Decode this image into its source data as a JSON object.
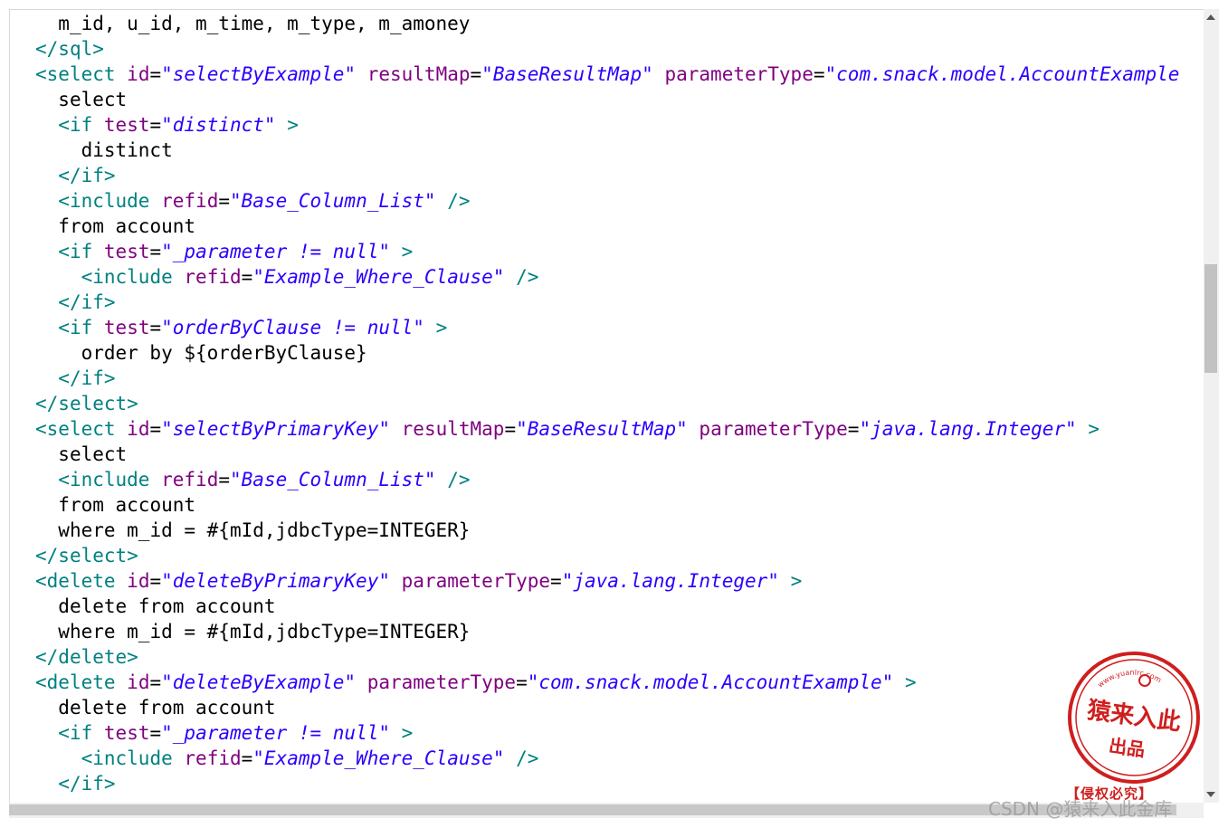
{
  "colors": {
    "tag": "#008080",
    "attribute": "#7f007f",
    "value": "#2a00ff",
    "text": "#000000",
    "stamp": "#d01e1e"
  },
  "code_lines": [
    {
      "indent": 1,
      "tokens": [
        {
          "t": "text",
          "v": "m_id, u_id, m_time, m_type, m_amoney"
        }
      ]
    },
    {
      "indent": 0,
      "tokens": [
        {
          "t": "bracket",
          "v": "</"
        },
        {
          "t": "tag",
          "v": "sql"
        },
        {
          "t": "bracket",
          "v": ">"
        }
      ]
    },
    {
      "indent": 0,
      "tokens": [
        {
          "t": "bracket",
          "v": "<"
        },
        {
          "t": "tag",
          "v": "select"
        },
        {
          "t": "text",
          "v": " "
        },
        {
          "t": "attr",
          "v": "id"
        },
        {
          "t": "eq",
          "v": "="
        },
        {
          "t": "val",
          "v": "\"selectByExample\""
        },
        {
          "t": "text",
          "v": " "
        },
        {
          "t": "attr",
          "v": "resultMap"
        },
        {
          "t": "eq",
          "v": "="
        },
        {
          "t": "val",
          "v": "\"BaseResultMap\""
        },
        {
          "t": "text",
          "v": " "
        },
        {
          "t": "attr",
          "v": "parameterType"
        },
        {
          "t": "eq",
          "v": "="
        },
        {
          "t": "val",
          "v": "\"com.snack.model.AccountExample"
        }
      ]
    },
    {
      "indent": 1,
      "tokens": [
        {
          "t": "text",
          "v": "select"
        }
      ]
    },
    {
      "indent": 1,
      "tokens": [
        {
          "t": "bracket",
          "v": "<"
        },
        {
          "t": "tag",
          "v": "if"
        },
        {
          "t": "text",
          "v": " "
        },
        {
          "t": "attr",
          "v": "test"
        },
        {
          "t": "eq",
          "v": "="
        },
        {
          "t": "val",
          "v": "\"distinct\""
        },
        {
          "t": "text",
          "v": " "
        },
        {
          "t": "bracket",
          "v": ">"
        }
      ]
    },
    {
      "indent": 2,
      "tokens": [
        {
          "t": "text",
          "v": "distinct"
        }
      ]
    },
    {
      "indent": 1,
      "tokens": [
        {
          "t": "bracket",
          "v": "</"
        },
        {
          "t": "tag",
          "v": "if"
        },
        {
          "t": "bracket",
          "v": ">"
        }
      ]
    },
    {
      "indent": 1,
      "tokens": [
        {
          "t": "bracket",
          "v": "<"
        },
        {
          "t": "tag",
          "v": "include"
        },
        {
          "t": "text",
          "v": " "
        },
        {
          "t": "attr",
          "v": "refid"
        },
        {
          "t": "eq",
          "v": "="
        },
        {
          "t": "val",
          "v": "\"Base_Column_List\""
        },
        {
          "t": "text",
          "v": " "
        },
        {
          "t": "bracket",
          "v": "/>"
        }
      ]
    },
    {
      "indent": 1,
      "tokens": [
        {
          "t": "text",
          "v": "from account"
        }
      ]
    },
    {
      "indent": 1,
      "tokens": [
        {
          "t": "bracket",
          "v": "<"
        },
        {
          "t": "tag",
          "v": "if"
        },
        {
          "t": "text",
          "v": " "
        },
        {
          "t": "attr",
          "v": "test"
        },
        {
          "t": "eq",
          "v": "="
        },
        {
          "t": "val",
          "v": "\"_parameter != null\""
        },
        {
          "t": "text",
          "v": " "
        },
        {
          "t": "bracket",
          "v": ">"
        }
      ]
    },
    {
      "indent": 2,
      "tokens": [
        {
          "t": "bracket",
          "v": "<"
        },
        {
          "t": "tag",
          "v": "include"
        },
        {
          "t": "text",
          "v": " "
        },
        {
          "t": "attr",
          "v": "refid"
        },
        {
          "t": "eq",
          "v": "="
        },
        {
          "t": "val",
          "v": "\"Example_Where_Clause\""
        },
        {
          "t": "text",
          "v": " "
        },
        {
          "t": "bracket",
          "v": "/>"
        }
      ]
    },
    {
      "indent": 1,
      "tokens": [
        {
          "t": "bracket",
          "v": "</"
        },
        {
          "t": "tag",
          "v": "if"
        },
        {
          "t": "bracket",
          "v": ">"
        }
      ]
    },
    {
      "indent": 1,
      "tokens": [
        {
          "t": "bracket",
          "v": "<"
        },
        {
          "t": "tag",
          "v": "if"
        },
        {
          "t": "text",
          "v": " "
        },
        {
          "t": "attr",
          "v": "test"
        },
        {
          "t": "eq",
          "v": "="
        },
        {
          "t": "val",
          "v": "\"orderByClause != null\""
        },
        {
          "t": "text",
          "v": " "
        },
        {
          "t": "bracket",
          "v": ">"
        }
      ]
    },
    {
      "indent": 2,
      "tokens": [
        {
          "t": "text",
          "v": "order by ${orderByClause}"
        }
      ]
    },
    {
      "indent": 1,
      "tokens": [
        {
          "t": "bracket",
          "v": "</"
        },
        {
          "t": "tag",
          "v": "if"
        },
        {
          "t": "bracket",
          "v": ">"
        }
      ]
    },
    {
      "indent": 0,
      "tokens": [
        {
          "t": "bracket",
          "v": "</"
        },
        {
          "t": "tag",
          "v": "select"
        },
        {
          "t": "bracket",
          "v": ">"
        }
      ]
    },
    {
      "indent": 0,
      "tokens": [
        {
          "t": "bracket",
          "v": "<"
        },
        {
          "t": "tag",
          "v": "select"
        },
        {
          "t": "text",
          "v": " "
        },
        {
          "t": "attr",
          "v": "id"
        },
        {
          "t": "eq",
          "v": "="
        },
        {
          "t": "val",
          "v": "\"selectByPrimaryKey\""
        },
        {
          "t": "text",
          "v": " "
        },
        {
          "t": "attr",
          "v": "resultMap"
        },
        {
          "t": "eq",
          "v": "="
        },
        {
          "t": "val",
          "v": "\"BaseResultMap\""
        },
        {
          "t": "text",
          "v": " "
        },
        {
          "t": "attr",
          "v": "parameterType"
        },
        {
          "t": "eq",
          "v": "="
        },
        {
          "t": "val",
          "v": "\"java.lang.Integer\""
        },
        {
          "t": "text",
          "v": " "
        },
        {
          "t": "bracket",
          "v": ">"
        }
      ]
    },
    {
      "indent": 1,
      "tokens": [
        {
          "t": "text",
          "v": "select"
        }
      ]
    },
    {
      "indent": 1,
      "tokens": [
        {
          "t": "bracket",
          "v": "<"
        },
        {
          "t": "tag",
          "v": "include"
        },
        {
          "t": "text",
          "v": " "
        },
        {
          "t": "attr",
          "v": "refid"
        },
        {
          "t": "eq",
          "v": "="
        },
        {
          "t": "val",
          "v": "\"Base_Column_List\""
        },
        {
          "t": "text",
          "v": " "
        },
        {
          "t": "bracket",
          "v": "/>"
        }
      ]
    },
    {
      "indent": 1,
      "tokens": [
        {
          "t": "text",
          "v": "from account"
        }
      ]
    },
    {
      "indent": 1,
      "tokens": [
        {
          "t": "text",
          "v": "where m_id = #{mId,jdbcType=INTEGER}"
        }
      ]
    },
    {
      "indent": 0,
      "tokens": [
        {
          "t": "bracket",
          "v": "</"
        },
        {
          "t": "tag",
          "v": "select"
        },
        {
          "t": "bracket",
          "v": ">"
        }
      ]
    },
    {
      "indent": 0,
      "tokens": [
        {
          "t": "bracket",
          "v": "<"
        },
        {
          "t": "tag",
          "v": "delete"
        },
        {
          "t": "text",
          "v": " "
        },
        {
          "t": "attr",
          "v": "id"
        },
        {
          "t": "eq",
          "v": "="
        },
        {
          "t": "val",
          "v": "\"deleteByPrimaryKey\""
        },
        {
          "t": "text",
          "v": " "
        },
        {
          "t": "attr",
          "v": "parameterType"
        },
        {
          "t": "eq",
          "v": "="
        },
        {
          "t": "val",
          "v": "\"java.lang.Integer\""
        },
        {
          "t": "text",
          "v": " "
        },
        {
          "t": "bracket",
          "v": ">"
        }
      ]
    },
    {
      "indent": 1,
      "tokens": [
        {
          "t": "text",
          "v": "delete from account"
        }
      ]
    },
    {
      "indent": 1,
      "tokens": [
        {
          "t": "text",
          "v": "where m_id = #{mId,jdbcType=INTEGER}"
        }
      ]
    },
    {
      "indent": 0,
      "tokens": [
        {
          "t": "bracket",
          "v": "</"
        },
        {
          "t": "tag",
          "v": "delete"
        },
        {
          "t": "bracket",
          "v": ">"
        }
      ]
    },
    {
      "indent": 0,
      "tokens": [
        {
          "t": "bracket",
          "v": "<"
        },
        {
          "t": "tag",
          "v": "delete"
        },
        {
          "t": "text",
          "v": " "
        },
        {
          "t": "attr",
          "v": "id"
        },
        {
          "t": "eq",
          "v": "="
        },
        {
          "t": "val",
          "v": "\"deleteByExample\""
        },
        {
          "t": "text",
          "v": " "
        },
        {
          "t": "attr",
          "v": "parameterType"
        },
        {
          "t": "eq",
          "v": "="
        },
        {
          "t": "val",
          "v": "\"com.snack.model.AccountExample\""
        },
        {
          "t": "text",
          "v": " "
        },
        {
          "t": "bracket",
          "v": ">"
        }
      ]
    },
    {
      "indent": 1,
      "tokens": [
        {
          "t": "text",
          "v": "delete from account"
        }
      ]
    },
    {
      "indent": 1,
      "tokens": [
        {
          "t": "bracket",
          "v": "<"
        },
        {
          "t": "tag",
          "v": "if"
        },
        {
          "t": "text",
          "v": " "
        },
        {
          "t": "attr",
          "v": "test"
        },
        {
          "t": "eq",
          "v": "="
        },
        {
          "t": "val",
          "v": "\"_parameter != null\""
        },
        {
          "t": "text",
          "v": " "
        },
        {
          "t": "bracket",
          "v": ">"
        }
      ]
    },
    {
      "indent": 2,
      "tokens": [
        {
          "t": "bracket",
          "v": "<"
        },
        {
          "t": "tag",
          "v": "include"
        },
        {
          "t": "text",
          "v": " "
        },
        {
          "t": "attr",
          "v": "refid"
        },
        {
          "t": "eq",
          "v": "="
        },
        {
          "t": "val",
          "v": "\"Example_Where_Clause\""
        },
        {
          "t": "text",
          "v": " "
        },
        {
          "t": "bracket",
          "v": "/>"
        }
      ]
    },
    {
      "indent": 1,
      "tokens": [
        {
          "t": "bracket",
          "v": "</"
        },
        {
          "t": "tag",
          "v": "if"
        },
        {
          "t": "bracket",
          "v": ">"
        }
      ]
    }
  ],
  "stamp": {
    "url_text": "www.yuanlrc.com",
    "main_text": "猿来入此",
    "sub_text": "出品",
    "caption": "【侵权必究】"
  },
  "watermark": "CSDN @猿来入此金库"
}
